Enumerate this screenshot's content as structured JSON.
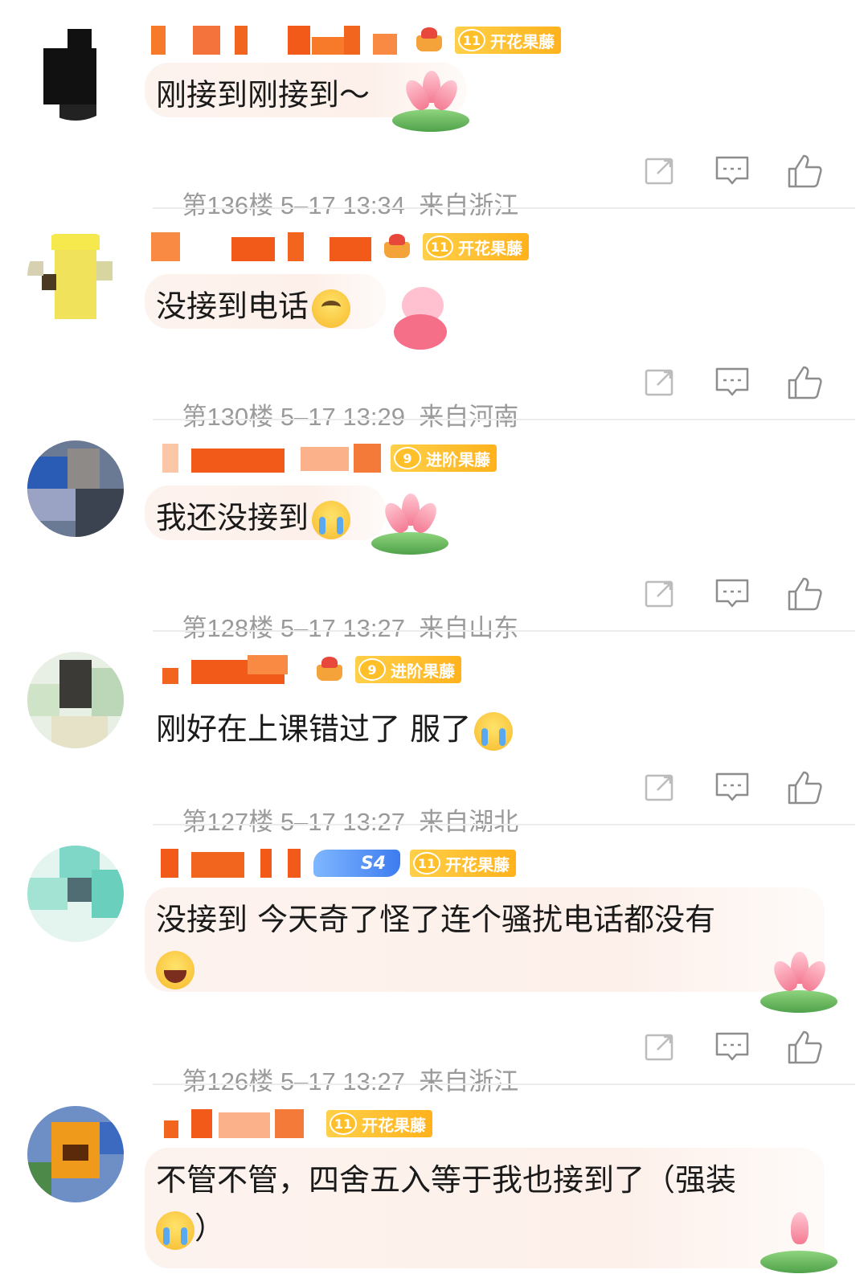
{
  "comments": [
    {
      "level_badge": {
        "level": "11",
        "title": "开花果藤"
      },
      "text": "刚接到刚接到～",
      "emoji": "",
      "floor": "第136楼",
      "date": "5–17",
      "time": "13:34",
      "location": "来自浙江",
      "decoration": "lotus-icon"
    },
    {
      "level_badge": {
        "level": "11",
        "title": "开花果藤"
      },
      "text": "没接到电话",
      "emoji": "sad-face-emoji",
      "floor": "第130楼",
      "date": "5–17",
      "time": "13:29",
      "location": "来自河南",
      "decoration": "bear-sticker-icon"
    },
    {
      "level_badge": {
        "level": "9",
        "title": "进阶果藤"
      },
      "text": "我还没接到",
      "emoji": "crying-face-emoji",
      "floor": "第128楼",
      "date": "5–17",
      "time": "13:27",
      "location": "来自山东",
      "decoration": "lotus-icon"
    },
    {
      "level_badge": {
        "level": "9",
        "title": "进阶果藤"
      },
      "text": "刚好在上课错过了 服了",
      "emoji": "crying-face-emoji",
      "floor": "第127楼",
      "date": "5–17",
      "time": "13:27",
      "location": "来自湖北",
      "decoration": ""
    },
    {
      "season_badge": "S4",
      "level_badge": {
        "level": "11",
        "title": "开花果藤"
      },
      "text": "没接到 今天奇了怪了连个骚扰电话都没有",
      "emoji": "laughing-tears-emoji",
      "floor": "第126楼",
      "date": "5–17",
      "time": "13:27",
      "location": "来自浙江",
      "decoration": "lotus-icon"
    },
    {
      "level_badge": {
        "level": "11",
        "title": "开花果藤"
      },
      "text": "不管不管，四舍五入等于我也接到了（强装",
      "text_tail": "）",
      "emoji": "crying-face-emoji",
      "decoration": "lotus-icon"
    }
  ],
  "icons": {
    "share": "share-icon",
    "reply": "comment-icon",
    "like": "thumbs-up-icon"
  },
  "colors": {
    "meta": "#9a9a9a",
    "badge": "#ffb21c",
    "bubble": "#fdf1eb",
    "divider": "#ececec"
  }
}
